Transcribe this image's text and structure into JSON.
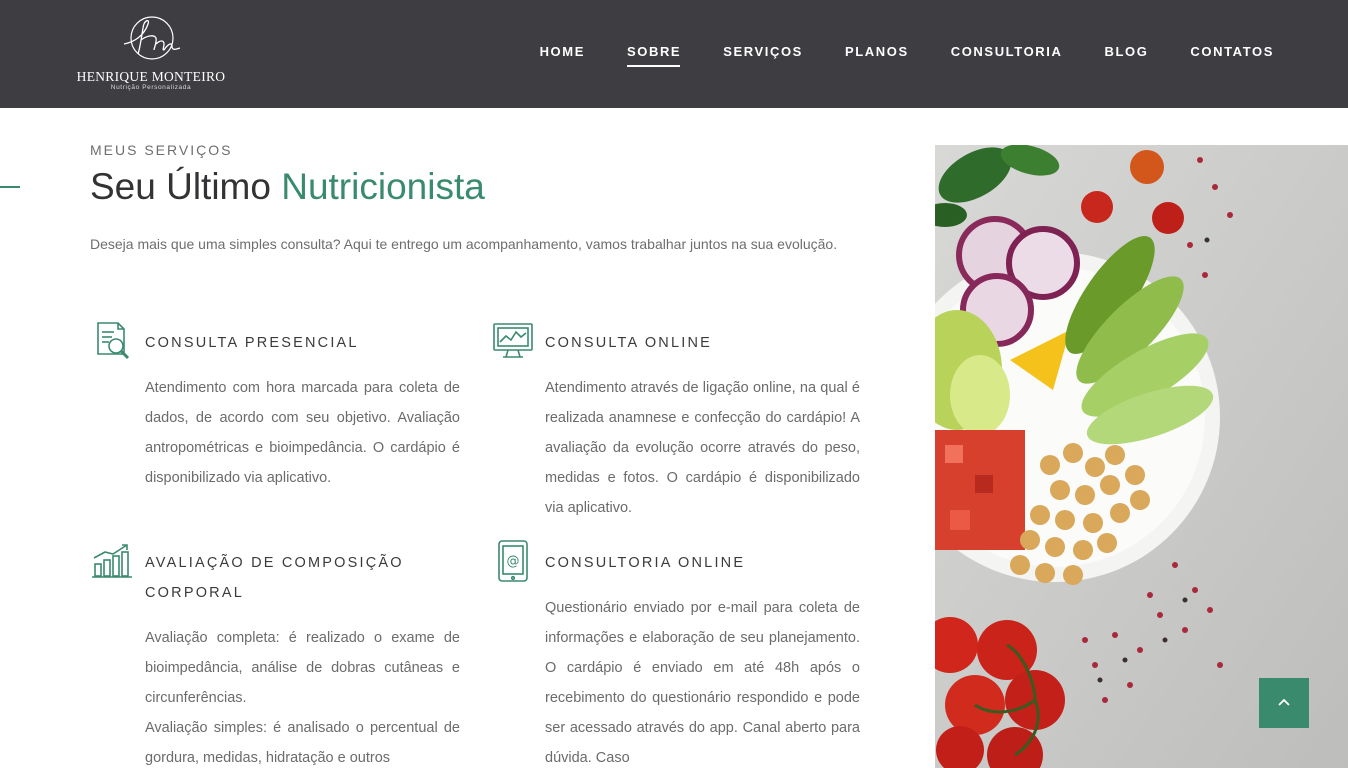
{
  "header": {
    "logo": {
      "name": "HENRIQUE MONTEIRO",
      "tagline": "Nutrição Personalizada",
      "monogram": "Hm"
    },
    "nav": [
      {
        "label": "HOME",
        "active": false
      },
      {
        "label": "SOBRE",
        "active": true
      },
      {
        "label": "SERVIÇOS",
        "active": false
      },
      {
        "label": "PLANOS",
        "active": false
      },
      {
        "label": "CONSULTORIA",
        "active": false
      },
      {
        "label": "BLOG",
        "active": false
      },
      {
        "label": "CONTATOS",
        "active": false
      }
    ]
  },
  "section": {
    "kicker": "MEUS SERVIÇOS",
    "title_main": "Seu Último ",
    "title_accent": "Nutricionista",
    "intro": "Deseja mais que uma simples consulta? Aqui te entrego um acompanhamento, vamos trabalhar juntos na sua evolução."
  },
  "services": [
    {
      "icon": "document-search-icon",
      "title": "CONSULTA PRESENCIAL",
      "paragraphs": [
        "Atendimento com hora marcada para coleta de dados, de acordo com seu objetivo. Avaliação antropométricas e bioimpedância. O cardápio é disponibilizado via aplicativo."
      ]
    },
    {
      "icon": "monitor-chart-icon",
      "title": "CONSULTA ONLINE",
      "paragraphs": [
        "Atendimento através de ligação online, na qual é realizada anamnese e confecção do cardápio! A avaliação da evolução ocorre através do peso, medidas e fotos. O cardápio é disponibilizado via aplicativo."
      ]
    },
    {
      "icon": "growth-chart-icon",
      "title": "AVALIAÇÃO DE COMPOSIÇÃO CORPORAL",
      "paragraphs": [
        "Avaliação completa: é realizado o exame de bioimpedância, análise de dobras cutâneas e circunferências.",
        "Avaliação simples: é analisado o percentual de gordura, medidas, hidratação e outros"
      ]
    },
    {
      "icon": "tablet-email-icon",
      "title": "CONSULTORIA ONLINE",
      "paragraphs": [
        "Questionário enviado por e-mail para coleta de informações e elaboração de seu planejamento. O cardápio é enviado em até 48h após o recebimento do questionário respondido e pode ser acessado através do app. Canal aberto para dúvida. Caso"
      ]
    }
  ],
  "colors": {
    "header_bg": "#3e3d42",
    "accent": "#3a8a6e",
    "text": "#6b6b6b",
    "heading": "#333336"
  },
  "scroll_top": {
    "icon": "chevron-up-icon"
  }
}
